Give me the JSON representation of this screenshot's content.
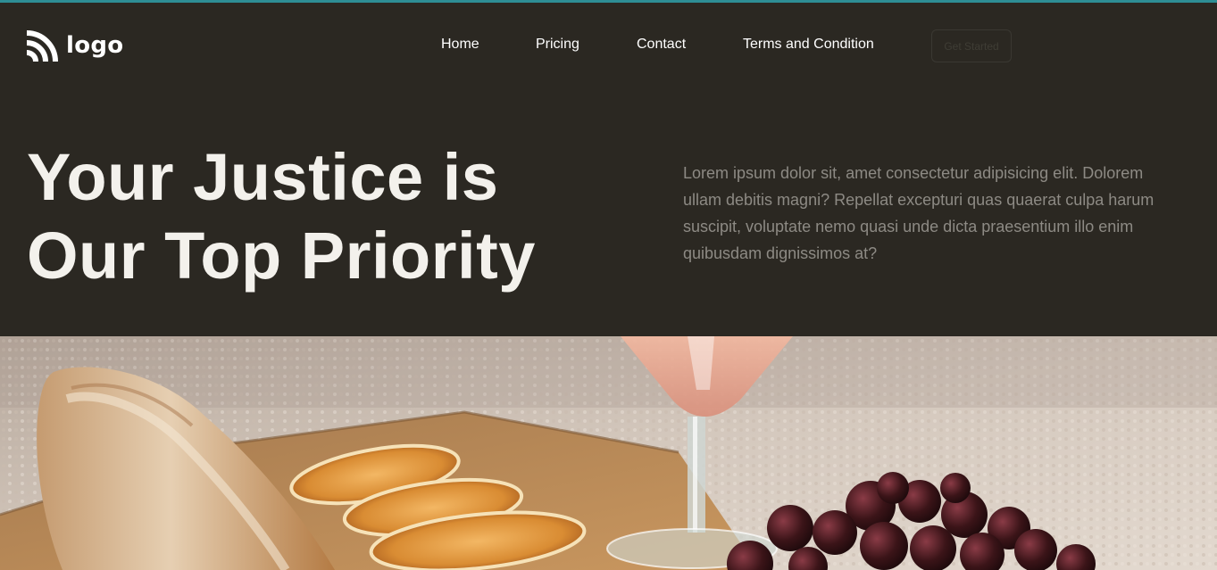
{
  "header": {
    "logo_text": "logo",
    "nav": [
      {
        "label": "Home"
      },
      {
        "label": "Pricing"
      },
      {
        "label": "Contact"
      },
      {
        "label": "Terms and Condition"
      }
    ],
    "cta_label": "Get Started"
  },
  "hero": {
    "title_line1": "Your Justice is",
    "title_line2": "Our Top Priority",
    "description": "Lorem ipsum dolor sit, amet consectetur adipisicing elit. Dolorem ullam debitis magni? Repellat excepturi quas quaerat culpa harum suscipit, voluptate nemo quasi unde dicta praesentium illo enim quibusdam dignissimos at?"
  },
  "icons": {
    "logo": "feed-logo-icon"
  },
  "colors": {
    "background": "#2b2822",
    "accent_line": "#2e8e95",
    "title": "#f3f1ec",
    "body_text": "#8d8a84"
  }
}
